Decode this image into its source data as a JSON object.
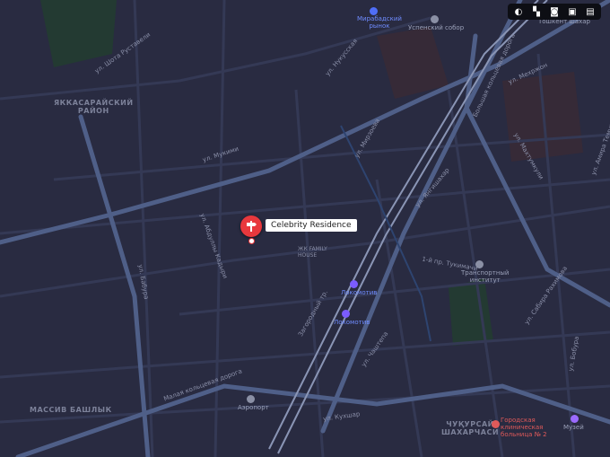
{
  "map": {
    "theme_colors": {
      "background": "#22243a",
      "road": "#3c4a6e",
      "major_road": "#5a6f9e",
      "building": "#2d2f45",
      "park": "#263c34",
      "water": "#2a3a5a"
    },
    "marker": {
      "label": "Celebrity Residence",
      "color": "#e8383d",
      "icon": "signpost-icon"
    },
    "districts": [
      {
        "id": "yakkasaray",
        "text": "ЯККАСАРАЙСКИЙ\nРАЙОН"
      },
      {
        "id": "bashlyk",
        "text": "МАССИВ БАШЛЫК"
      },
      {
        "id": "shakhar",
        "text": "ЧУҚУРСАЙ\nШАХАРЧАСИ"
      },
      {
        "id": "jk",
        "text": "ЖК FAMILY\nHOUSE"
      }
    ],
    "pois": [
      {
        "id": "mirabad",
        "text": "Мирабадский\nрынок",
        "icon": "shopping-icon",
        "color": "#4f6ef7"
      },
      {
        "id": "uspensky",
        "text": "Успенский собор",
        "icon": "church-icon",
        "color": "#8b90a5"
      },
      {
        "id": "lokomotiv1",
        "text": "Локомотив",
        "icon": "stadium-icon",
        "color": "#7b5cff"
      },
      {
        "id": "lokomotiv2",
        "text": "Локомотив",
        "icon": "stadium-icon",
        "color": "#7b5cff"
      },
      {
        "id": "transport",
        "text": "Транспортный\nинститут",
        "icon": "university-icon",
        "color": "#8b90a5"
      },
      {
        "id": "hospital",
        "text": "Городская\nклиническая\nбольница № 2",
        "icon": "hospital-icon",
        "color": "#e05a5a"
      },
      {
        "id": "museum",
        "text": "Музей",
        "icon": "museum-icon",
        "color": "#9b6bff"
      },
      {
        "id": "airport",
        "text": "Аэропорт",
        "icon": "metro-icon",
        "color": "#8b90a5"
      },
      {
        "id": "tashkent",
        "text": "Тошкент шахар",
        "icon": "",
        "color": "#8b90a5"
      }
    ],
    "streets": [
      {
        "id": "s1",
        "text": "ул. Мукими"
      },
      {
        "id": "s2",
        "text": "ул. Бабура"
      },
      {
        "id": "s3",
        "text": "Малая кольцевая дорога"
      },
      {
        "id": "s4",
        "text": "ул. Кухшар"
      },
      {
        "id": "s5",
        "text": "ул. Шота Руставели"
      },
      {
        "id": "s6",
        "text": "ул. Абдуллы Кадыри"
      },
      {
        "id": "s7",
        "text": "Загородный тр."
      },
      {
        "id": "s8",
        "text": "ул. Мирзоева"
      },
      {
        "id": "s9",
        "text": "ул. Нукусская"
      },
      {
        "id": "s10",
        "text": "Большая кольцевая дорога"
      },
      {
        "id": "s11",
        "text": "ул. Янгишахар"
      },
      {
        "id": "s12",
        "text": "ул. Чаштепа"
      },
      {
        "id": "s13",
        "text": "ул. Махтумкули"
      },
      {
        "id": "s14",
        "text": "ул. Сабира Рахимова"
      },
      {
        "id": "s15",
        "text": "ул. Бобура"
      },
      {
        "id": "s16",
        "text": "ул. Амира Темура"
      },
      {
        "id": "s17",
        "text": "1-й пр. Тукимачи"
      },
      {
        "id": "s18",
        "text": "ул. Мехржон"
      }
    ]
  },
  "toolbar": {
    "buttons": [
      {
        "id": "layers",
        "icon": "layers-icon",
        "glyph": "◐"
      },
      {
        "id": "traffic",
        "icon": "traffic-icon",
        "glyph": "▚"
      },
      {
        "id": "camera",
        "icon": "camera-icon",
        "glyph": "◙"
      },
      {
        "id": "transit",
        "icon": "bus-icon",
        "glyph": "▣"
      },
      {
        "id": "panorama",
        "icon": "panorama-icon",
        "glyph": "▤"
      }
    ]
  }
}
